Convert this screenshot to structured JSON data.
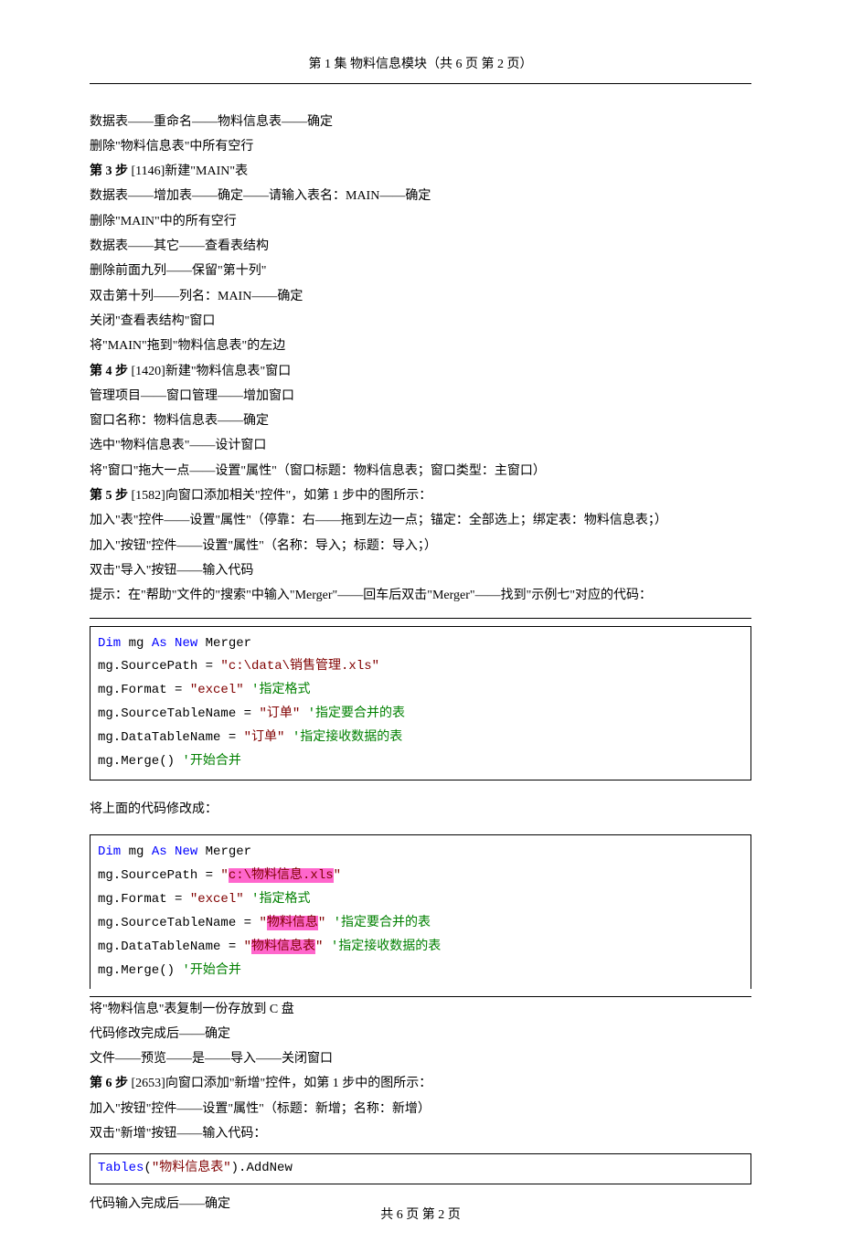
{
  "header": "第 1 集 物料信息模块（共 6 页 第 2 页）",
  "lines": {
    "l1": "数据表——重命名——物料信息表——确定",
    "l2": "删除\"物料信息表\"中所有空行",
    "s3p": "第 3 步",
    "s3r": " [1146]新建\"MAIN\"表",
    "l3": "数据表——增加表——确定——请输入表名：MAIN——确定",
    "l4": "删除\"MAIN\"中的所有空行",
    "l5": "数据表——其它——查看表结构",
    "l6": "删除前面九列——保留\"第十列\"",
    "l7": "双击第十列——列名：MAIN——确定",
    "l8": "关闭\"查看表结构\"窗口",
    "l9": "将\"MAIN\"拖到\"物料信息表\"的左边",
    "s4p": "第 4 步",
    "s4r": " [1420]新建\"物料信息表\"窗口",
    "l10": "管理项目——窗口管理——增加窗口",
    "l11": "窗口名称：物料信息表——确定",
    "l12": "选中\"物料信息表\"——设计窗口",
    "l13": "将\"窗口\"拖大一点——设置\"属性\"（窗口标题：物料信息表；窗口类型：主窗口）",
    "s5p": "第 5 步",
    "s5r": " [1582]向窗口添加相关\"控件\"，如第 1 步中的图所示：",
    "l14": "加入\"表\"控件——设置\"属性\"（停靠：右——拖到左边一点；锚定：全部选上；绑定表：物料信息表；）",
    "l15": "加入\"按钮\"控件——设置\"属性\"（名称：导入；标题：导入；）",
    "l16": "双击\"导入\"按钮——输入代码",
    "l17": "提示：在\"帮助\"文件的\"搜索\"中输入\"Merger\"——回车后双击\"Merger\"——找到\"示例七\"对应的代码：",
    "l18": "将上面的代码修改成：",
    "l19": "将\"物料信息\"表复制一份存放到 C 盘",
    "l20": "代码修改完成后——确定",
    "l21": "文件——预览——是——导入——关闭窗口",
    "s6p": "第 6 步",
    "s6r": " [2653]向窗口添加\"新增\"控件，如第 1 步中的图所示：",
    "l22": "加入\"按钮\"控件——设置\"属性\"（标题：新增；名称：新增）",
    "l23": "双击\"新增\"按钮——输入代码：",
    "l24": "代码输入完成后——确定"
  },
  "code1": {
    "dim": "Dim",
    "mg": " mg ",
    "as": "As",
    "new": " New",
    "merger": " Merger",
    "sp": "mg.SourcePath = ",
    "spv": "\"c:\\data\\销售管理.xls\"",
    "fm": "mg.Format = ",
    "fmv": "\"excel\"",
    "fmc": " '指定格式",
    "stn": "mg.SourceTableName = ",
    "stnv": "\"订单\"",
    "stnc": " '指定要合并的表",
    "dtn": "mg.DataTableName = ",
    "dtnv": "\"订单\"",
    "dtnc": " '指定接收数据的表",
    "mrg": "mg.Merge()",
    "mrgc": " '开始合并"
  },
  "code2": {
    "sp": "mg.SourcePath = ",
    "spq1": "\"",
    "spv": "c:\\物料信息.xls",
    "spq2": "\"",
    "stn": "mg.SourceTableName = ",
    "stnq1": "\"",
    "stnv": "物料信息",
    "stnq2": "\"",
    "stnc": " '指定要合并的表",
    "dtn": "mg.DataTableName = ",
    "dtnq1": "\"",
    "dtnv": "物料信息表",
    "dtnq2": "\"",
    "dtnc": " '指定接收数据的表"
  },
  "code3": {
    "tables": "Tables",
    "paren1": "(",
    "tablev": "\"物料信息表\"",
    "paren2": ")",
    "addnew": ".AddNew"
  },
  "footer": "共 6 页 第 2 页"
}
